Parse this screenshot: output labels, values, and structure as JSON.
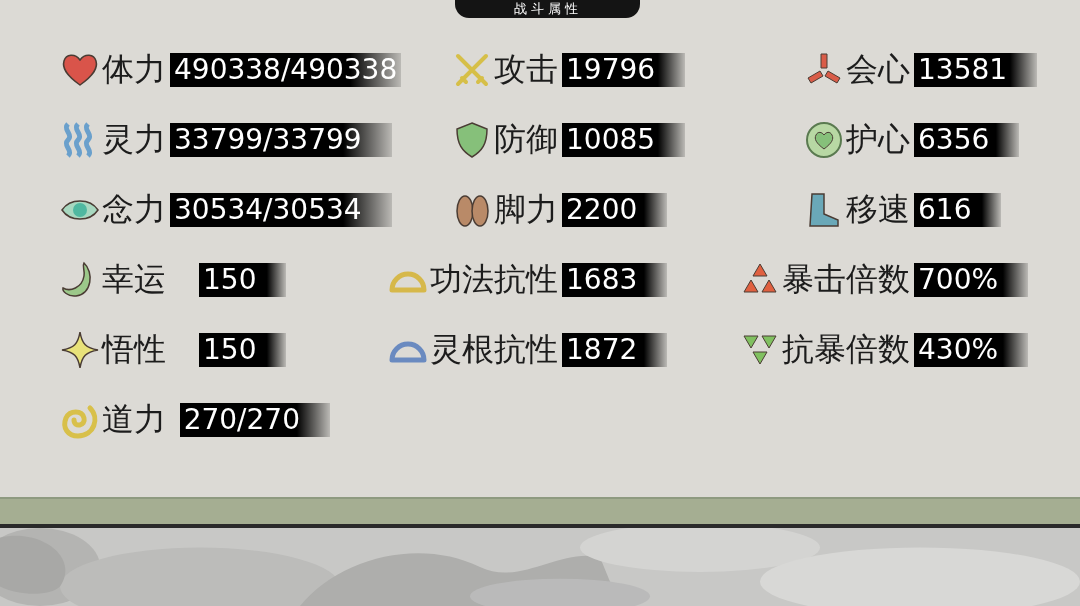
{
  "title": "战斗属性",
  "stats": [
    {
      "label": "体力",
      "value": "490338/490338"
    },
    {
      "label": "攻击",
      "value": "19796"
    },
    {
      "label": "会心",
      "value": "13581"
    },
    {
      "label": "灵力",
      "value": "33799/33799"
    },
    {
      "label": "防御",
      "value": "10085"
    },
    {
      "label": "护心",
      "value": "6356"
    },
    {
      "label": "念力",
      "value": "30534/30534"
    },
    {
      "label": "脚力",
      "value": "2200"
    },
    {
      "label": "移速",
      "value": "616"
    },
    {
      "label": "幸运",
      "value": "150"
    },
    {
      "label": "功法抗性",
      "value": "1683"
    },
    {
      "label": "暴击倍数",
      "value": "700%"
    },
    {
      "label": "悟性",
      "value": "150"
    },
    {
      "label": "灵根抗性",
      "value": "1872"
    },
    {
      "label": "抗暴倍数",
      "value": "430%"
    },
    {
      "label": "道力",
      "value": "270/270"
    }
  ]
}
